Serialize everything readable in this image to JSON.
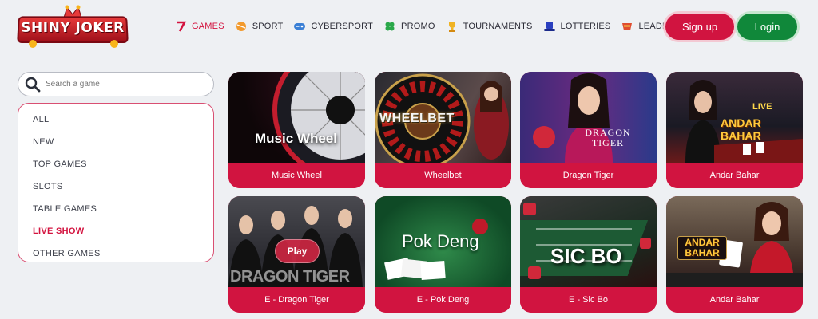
{
  "brand": {
    "name": "SHINY JOKER"
  },
  "nav": [
    {
      "label": "GAMES",
      "icon": "seven-icon",
      "active": true
    },
    {
      "label": "SPORT",
      "icon": "ball-icon"
    },
    {
      "label": "CYBERSPORT",
      "icon": "gamepad-icon"
    },
    {
      "label": "PROMO",
      "icon": "clover-icon"
    },
    {
      "label": "TOURNAMENTS",
      "icon": "trophy-icon"
    },
    {
      "label": "LOTTERIES",
      "icon": "top-hat-icon"
    },
    {
      "label": "LEADERBOARD",
      "icon": "badge-icon"
    }
  ],
  "auth": {
    "signup": "Sign up",
    "login": "Login"
  },
  "search": {
    "placeholder": "Search a game"
  },
  "categories": [
    {
      "label": "ALL"
    },
    {
      "label": "NEW"
    },
    {
      "label": "TOP GAMES"
    },
    {
      "label": "SLOTS"
    },
    {
      "label": "TABLE GAMES"
    },
    {
      "label": "LIVE SHOW",
      "active": true
    },
    {
      "label": "OTHER GAMES"
    }
  ],
  "games": [
    {
      "name": "Music Wheel",
      "thumb_text": "Music Wheel"
    },
    {
      "name": "Wheelbet",
      "thumb_text": "WHEELBET"
    },
    {
      "name": "Dragon Tiger",
      "thumb_text": "DRAGON TIGER"
    },
    {
      "name": "Andar Bahar",
      "thumb_text": "ANDAR BAHAR",
      "thumb_badge": "LIVE"
    },
    {
      "name": "E - Dragon Tiger",
      "thumb_text": "DRAGON TIGER",
      "play_label": "Play"
    },
    {
      "name": "E - Pok Deng",
      "thumb_text": "Pok Deng"
    },
    {
      "name": "E - Sic Bo",
      "thumb_text": "SIC BO"
    },
    {
      "name": "Andar Bahar",
      "thumb_text": "ANDAR BAHAR"
    }
  ],
  "colors": {
    "accent": "#d11440",
    "login": "#10883a",
    "background": "#eef0f3"
  }
}
